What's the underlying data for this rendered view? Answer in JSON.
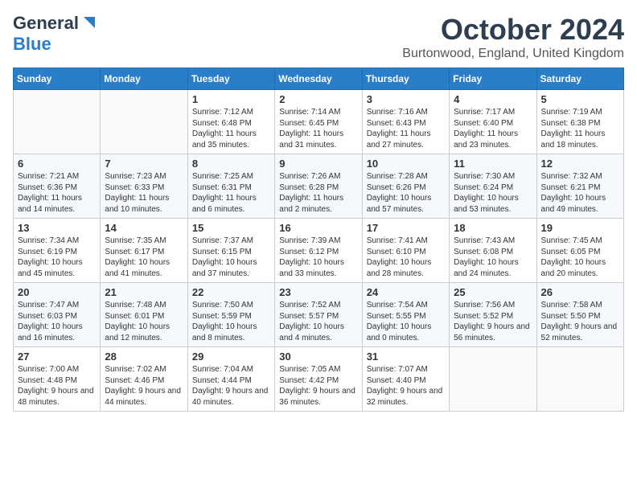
{
  "header": {
    "logo_line1": "General",
    "logo_line2": "Blue",
    "month": "October 2024",
    "location": "Burtonwood, England, United Kingdom"
  },
  "days_of_week": [
    "Sunday",
    "Monday",
    "Tuesday",
    "Wednesday",
    "Thursday",
    "Friday",
    "Saturday"
  ],
  "weeks": [
    [
      {
        "day": "",
        "empty": true
      },
      {
        "day": "",
        "empty": true
      },
      {
        "day": "1",
        "sunrise": "7:12 AM",
        "sunset": "6:48 PM",
        "daylight": "11 hours and 35 minutes."
      },
      {
        "day": "2",
        "sunrise": "7:14 AM",
        "sunset": "6:45 PM",
        "daylight": "11 hours and 31 minutes."
      },
      {
        "day": "3",
        "sunrise": "7:16 AM",
        "sunset": "6:43 PM",
        "daylight": "11 hours and 27 minutes."
      },
      {
        "day": "4",
        "sunrise": "7:17 AM",
        "sunset": "6:40 PM",
        "daylight": "11 hours and 23 minutes."
      },
      {
        "day": "5",
        "sunrise": "7:19 AM",
        "sunset": "6:38 PM",
        "daylight": "11 hours and 18 minutes."
      }
    ],
    [
      {
        "day": "6",
        "sunrise": "7:21 AM",
        "sunset": "6:36 PM",
        "daylight": "11 hours and 14 minutes."
      },
      {
        "day": "7",
        "sunrise": "7:23 AM",
        "sunset": "6:33 PM",
        "daylight": "11 hours and 10 minutes."
      },
      {
        "day": "8",
        "sunrise": "7:25 AM",
        "sunset": "6:31 PM",
        "daylight": "11 hours and 6 minutes."
      },
      {
        "day": "9",
        "sunrise": "7:26 AM",
        "sunset": "6:28 PM",
        "daylight": "11 hours and 2 minutes."
      },
      {
        "day": "10",
        "sunrise": "7:28 AM",
        "sunset": "6:26 PM",
        "daylight": "10 hours and 57 minutes."
      },
      {
        "day": "11",
        "sunrise": "7:30 AM",
        "sunset": "6:24 PM",
        "daylight": "10 hours and 53 minutes."
      },
      {
        "day": "12",
        "sunrise": "7:32 AM",
        "sunset": "6:21 PM",
        "daylight": "10 hours and 49 minutes."
      }
    ],
    [
      {
        "day": "13",
        "sunrise": "7:34 AM",
        "sunset": "6:19 PM",
        "daylight": "10 hours and 45 minutes."
      },
      {
        "day": "14",
        "sunrise": "7:35 AM",
        "sunset": "6:17 PM",
        "daylight": "10 hours and 41 minutes."
      },
      {
        "day": "15",
        "sunrise": "7:37 AM",
        "sunset": "6:15 PM",
        "daylight": "10 hours and 37 minutes."
      },
      {
        "day": "16",
        "sunrise": "7:39 AM",
        "sunset": "6:12 PM",
        "daylight": "10 hours and 33 minutes."
      },
      {
        "day": "17",
        "sunrise": "7:41 AM",
        "sunset": "6:10 PM",
        "daylight": "10 hours and 28 minutes."
      },
      {
        "day": "18",
        "sunrise": "7:43 AM",
        "sunset": "6:08 PM",
        "daylight": "10 hours and 24 minutes."
      },
      {
        "day": "19",
        "sunrise": "7:45 AM",
        "sunset": "6:05 PM",
        "daylight": "10 hours and 20 minutes."
      }
    ],
    [
      {
        "day": "20",
        "sunrise": "7:47 AM",
        "sunset": "6:03 PM",
        "daylight": "10 hours and 16 minutes."
      },
      {
        "day": "21",
        "sunrise": "7:48 AM",
        "sunset": "6:01 PM",
        "daylight": "10 hours and 12 minutes."
      },
      {
        "day": "22",
        "sunrise": "7:50 AM",
        "sunset": "5:59 PM",
        "daylight": "10 hours and 8 minutes."
      },
      {
        "day": "23",
        "sunrise": "7:52 AM",
        "sunset": "5:57 PM",
        "daylight": "10 hours and 4 minutes."
      },
      {
        "day": "24",
        "sunrise": "7:54 AM",
        "sunset": "5:55 PM",
        "daylight": "10 hours and 0 minutes."
      },
      {
        "day": "25",
        "sunrise": "7:56 AM",
        "sunset": "5:52 PM",
        "daylight": "9 hours and 56 minutes."
      },
      {
        "day": "26",
        "sunrise": "7:58 AM",
        "sunset": "5:50 PM",
        "daylight": "9 hours and 52 minutes."
      }
    ],
    [
      {
        "day": "27",
        "sunrise": "7:00 AM",
        "sunset": "4:48 PM",
        "daylight": "9 hours and 48 minutes."
      },
      {
        "day": "28",
        "sunrise": "7:02 AM",
        "sunset": "4:46 PM",
        "daylight": "9 hours and 44 minutes."
      },
      {
        "day": "29",
        "sunrise": "7:04 AM",
        "sunset": "4:44 PM",
        "daylight": "9 hours and 40 minutes."
      },
      {
        "day": "30",
        "sunrise": "7:05 AM",
        "sunset": "4:42 PM",
        "daylight": "9 hours and 36 minutes."
      },
      {
        "day": "31",
        "sunrise": "7:07 AM",
        "sunset": "4:40 PM",
        "daylight": "9 hours and 32 minutes."
      },
      {
        "day": "",
        "empty": true
      },
      {
        "day": "",
        "empty": true
      }
    ]
  ],
  "labels": {
    "sunrise": "Sunrise:",
    "sunset": "Sunset:",
    "daylight": "Daylight:"
  }
}
